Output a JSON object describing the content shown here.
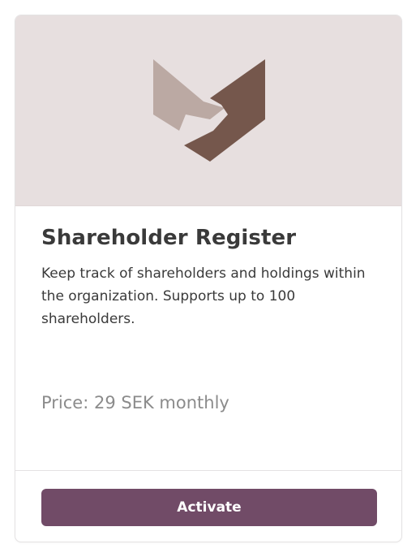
{
  "card": {
    "title": "Shareholder Register",
    "description": "Keep track of shareholders and holdings within the organization. Supports up to 100 shareholders.",
    "price": "Price: 29 SEK monthly",
    "activate_label": "Activate",
    "logo_icon": "brand-logo-icon"
  },
  "colors": {
    "hero_background": "#e7dfdf",
    "logo_light": "#bba9a3",
    "logo_dark": "#75574c",
    "button_background": "#714b67",
    "button_text": "#ffffff",
    "price_text": "#8b8b8b"
  }
}
